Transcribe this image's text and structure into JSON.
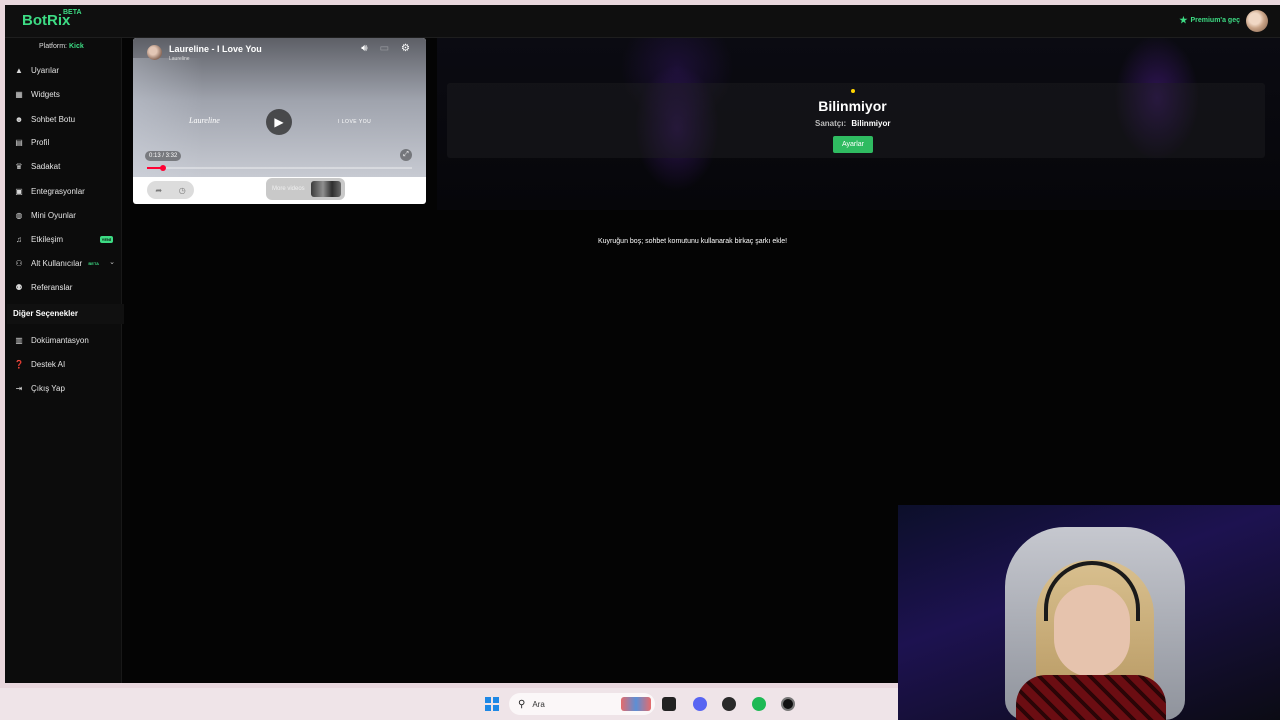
{
  "app": {
    "logo": "BotRix",
    "logo_badge": "BETA",
    "premium_label": "Premium'a geç",
    "platform_label": "Platform:",
    "platform_value": "Kick"
  },
  "sidebar": {
    "items": [
      {
        "label": "Uyarılar",
        "icon": "alert-icon"
      },
      {
        "label": "Widgets",
        "icon": "widgets-icon"
      },
      {
        "label": "Sohbet Botu",
        "icon": "robot-icon"
      },
      {
        "label": "Profil",
        "icon": "profile-icon"
      },
      {
        "label": "Sadakat",
        "icon": "trophy-icon"
      },
      {
        "label": "Entegrasyonlar",
        "icon": "integrations-icon"
      },
      {
        "label": "Mini Oyunlar",
        "icon": "gamepad-icon"
      },
      {
        "label": "Etkileşim",
        "icon": "music-note-icon",
        "badge": "YENİ"
      },
      {
        "label": "Alt Kullanıcılar",
        "icon": "sub-users-icon",
        "badge": "BETA"
      },
      {
        "label": "Referanslar",
        "icon": "referrals-icon"
      }
    ],
    "section_title": "Diğer Seçenekler",
    "other_items": [
      {
        "label": "Dokümantasyon",
        "icon": "docs-icon"
      },
      {
        "label": "Destek AI",
        "icon": "help-icon"
      },
      {
        "label": "Çıkış Yap",
        "icon": "logout-icon"
      }
    ]
  },
  "player": {
    "title": "Laureline - I Love You",
    "channel": "Laureline",
    "overlay_left_text": "Laureline",
    "overlay_right_text": "I LOVE YOU",
    "time": "0:13 / 3:32",
    "progress": 0.06,
    "more_videos_label": "More videos"
  },
  "now_playing": {
    "title": "Bilinmiyor",
    "artist_label": "Sanatçı:",
    "artist_value": "Bilinmiyor",
    "settings_button": "Ayarlar"
  },
  "queue": {
    "empty_message": "Kuyruğun boş; sohbet komutunu kullanarak birkaç şarkı ekle!"
  },
  "taskbar": {
    "search_placeholder": "Ara"
  },
  "colors": {
    "accent": "#3ddc84",
    "button_green": "#2fbb61",
    "progress_red": "#ff0033",
    "status_dot": "#ffd400"
  }
}
